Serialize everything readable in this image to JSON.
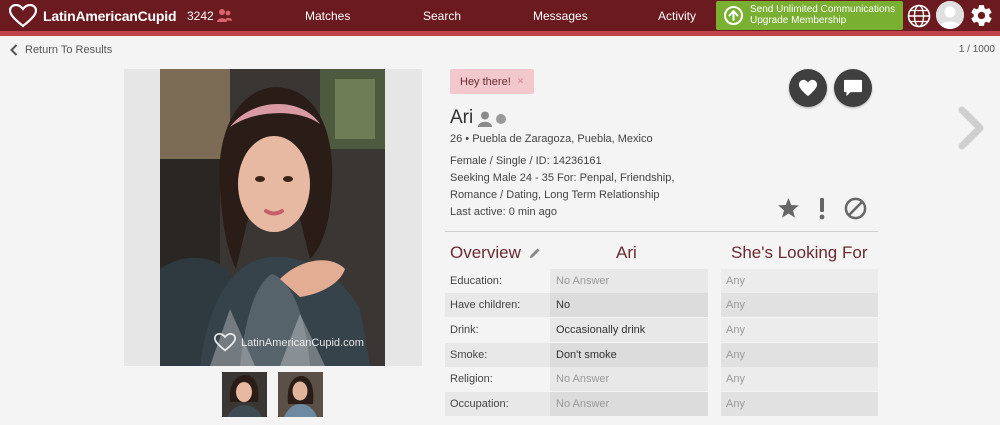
{
  "header": {
    "logo_text": "LatinAmericanCupid",
    "count": "3242",
    "nav": [
      "Matches",
      "Search",
      "Messages",
      "Activity"
    ],
    "upgrade_line1": "Send Unlimited Communications",
    "upgrade_line2": "Upgrade Membership",
    "brand_color": "#6b1a1f",
    "accent_color": "#79b031"
  },
  "subbar": {
    "back_label": "Return To Results",
    "pager": "1 / 1000"
  },
  "photo": {
    "watermark": "LatinAmericanCupid.com"
  },
  "profile": {
    "hey_label": "Hey there!",
    "name": "Ari",
    "location": "26 • Puebla de Zaragoza, Puebla, Mexico",
    "details": "Female / Single / ID: 14236161",
    "seeking_line1": "Seeking Male 24 - 35 For: Penpal, Friendship,",
    "seeking_line2": "Romance / Dating, Long Term Relationship",
    "last_active": "Last active: 0 min ago"
  },
  "table": {
    "col_overview": "Overview",
    "col_member": "Ari",
    "col_looking": "She's Looking For",
    "rows": [
      {
        "label": "Education:",
        "value": "No Answer",
        "looking": "Any"
      },
      {
        "label": "Have children:",
        "value": "No",
        "looking": "Any"
      },
      {
        "label": "Drink:",
        "value": "Occasionally drink",
        "looking": "Any"
      },
      {
        "label": "Smoke:",
        "value": "Don't smoke",
        "looking": "Any"
      },
      {
        "label": "Religion:",
        "value": "No Answer",
        "looking": "Any"
      },
      {
        "label": "Occupation:",
        "value": "No Answer",
        "looking": "Any"
      }
    ]
  }
}
